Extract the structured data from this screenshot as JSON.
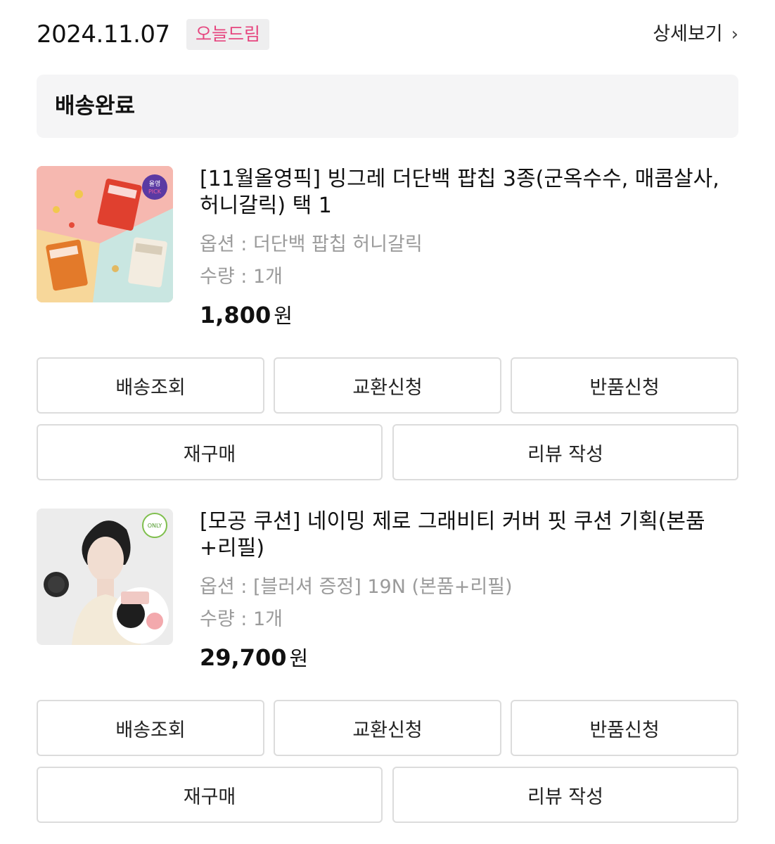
{
  "header": {
    "date": "2024.11.07",
    "badge": "오늘드림",
    "detail_label": "상세보기",
    "chevron": "›"
  },
  "status": {
    "label": "배송완료"
  },
  "colors": {
    "badge_text": "#e6467f",
    "badge_bg": "#eeeeef",
    "status_bg": "#f5f5f6",
    "muted_text": "#9b9b9b",
    "button_border": "#dcdcdc"
  },
  "products": [
    {
      "title": "[11월올영픽] 빙그레 더단백 팝칩 3종(군옥수수, 매콤살사, 허니갈릭) 택 1",
      "option": "옵션 : 더단백 팝칩 허니갈릭",
      "quantity": "수량 : 1개",
      "price": "1,800",
      "currency": "원",
      "image_icon": "snack-product-image",
      "buttons": {
        "track": "배송조회",
        "exchange": "교환신청",
        "return": "반품신청",
        "rebuy": "재구매",
        "review": "리뷰 작성"
      }
    },
    {
      "title": "[모공 쿠션] 네이밍 제로 그래비티 커버 핏 쿠션 기획(본품+리필)",
      "option": "옵션 : [블러셔 증정] 19N (본품+리필)",
      "quantity": "수량 : 1개",
      "price": "29,700",
      "currency": "원",
      "image_icon": "cushion-product-image",
      "buttons": {
        "track": "배송조회",
        "exchange": "교환신청",
        "return": "반품신청",
        "rebuy": "재구매",
        "review": "리뷰 작성"
      }
    }
  ]
}
